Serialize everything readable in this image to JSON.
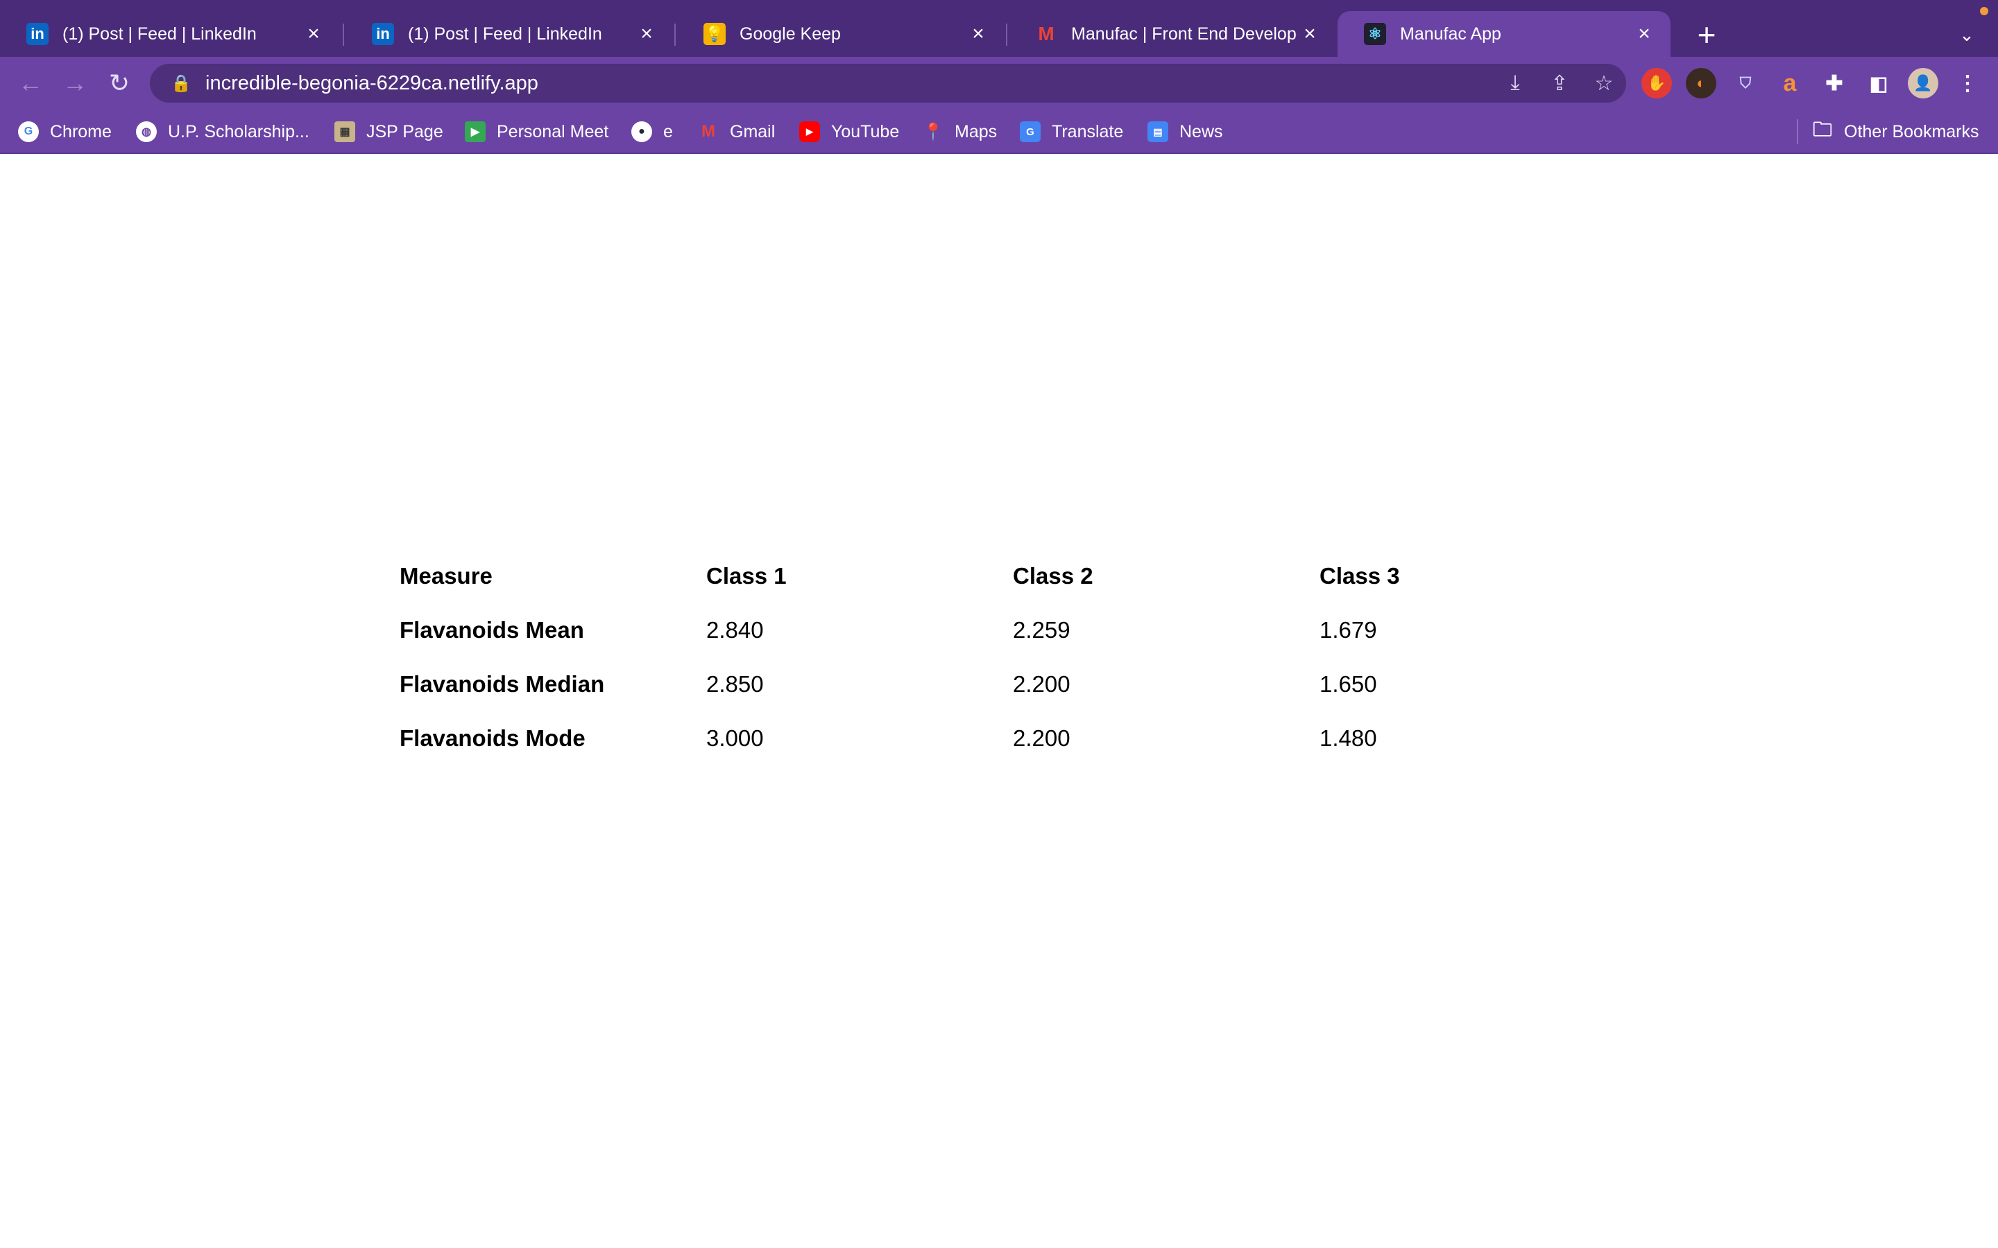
{
  "tabs": [
    {
      "title": "(1) Post | Feed | LinkedIn",
      "icon": "linkedin-icon",
      "active": false
    },
    {
      "title": "(1) Post | Feed | LinkedIn",
      "icon": "linkedin-icon",
      "active": false
    },
    {
      "title": "Google Keep",
      "icon": "keep-icon",
      "active": false
    },
    {
      "title": "Manufac | Front End Developer",
      "icon": "gmail-icon",
      "active": false
    },
    {
      "title": "Manufac App",
      "icon": "react-icon",
      "active": true
    }
  ],
  "toolbar": {
    "url": "incredible-begonia-6229ca.netlify.app"
  },
  "bookmarks": [
    {
      "label": "Chrome",
      "icon": "google-icon"
    },
    {
      "label": "U.P. Scholarship...",
      "icon": "globe-icon"
    },
    {
      "label": "JSP Page",
      "icon": "jsp-icon"
    },
    {
      "label": "Personal Meet",
      "icon": "meet-icon"
    },
    {
      "label": "e",
      "icon": "github-icon"
    },
    {
      "label": "Gmail",
      "icon": "gmail-icon"
    },
    {
      "label": "YouTube",
      "icon": "youtube-icon"
    },
    {
      "label": "Maps",
      "icon": "maps-icon"
    },
    {
      "label": "Translate",
      "icon": "translate-icon"
    },
    {
      "label": "News",
      "icon": "news-icon"
    }
  ],
  "other_bookmarks": "Other Bookmarks",
  "table": {
    "headers": [
      "Measure",
      "Class 1",
      "Class 2",
      "Class 3"
    ],
    "rows": [
      [
        "Flavanoids Mean",
        "2.840",
        "2.259",
        "1.679"
      ],
      [
        "Flavanoids Median",
        "2.850",
        "2.200",
        "1.650"
      ],
      [
        "Flavanoids Mode",
        "3.000",
        "2.200",
        "1.480"
      ]
    ]
  },
  "colors": {
    "tabstrip": "#4a2b79",
    "toolbar": "#6b43a5",
    "omnibox": "#4d2f7c",
    "page": "#ffffff"
  }
}
